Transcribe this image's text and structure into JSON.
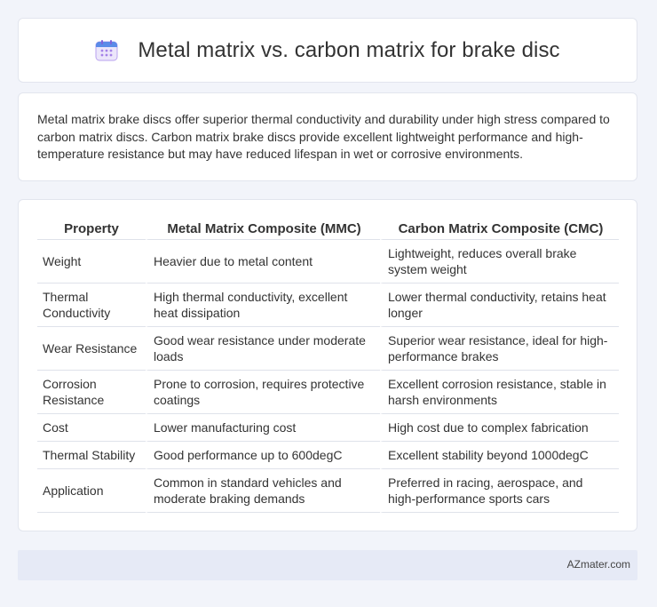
{
  "header": {
    "title": "Metal matrix vs. carbon matrix for brake disc",
    "icon": "calendar-icon"
  },
  "summary": {
    "text": "Metal matrix brake discs offer superior thermal conductivity and durability under high stress compared to carbon matrix discs. Carbon matrix brake discs provide excellent lightweight performance and high-temperature resistance but may have reduced lifespan in wet or corrosive environments."
  },
  "table": {
    "headers": [
      "Property",
      "Metal Matrix Composite (MMC)",
      "Carbon Matrix Composite (CMC)"
    ],
    "rows": [
      [
        "Weight",
        "Heavier due to metal content",
        "Lightweight, reduces overall brake system weight"
      ],
      [
        "Thermal Conductivity",
        "High thermal conductivity, excellent heat dissipation",
        "Lower thermal conductivity, retains heat longer"
      ],
      [
        "Wear Resistance",
        "Good wear resistance under moderate loads",
        "Superior wear resistance, ideal for high-performance brakes"
      ],
      [
        "Corrosion Resistance",
        "Prone to corrosion, requires protective coatings",
        "Excellent corrosion resistance, stable in harsh environments"
      ],
      [
        "Cost",
        "Lower manufacturing cost",
        "High cost due to complex fabrication"
      ],
      [
        "Thermal Stability",
        "Good performance up to 600degC",
        "Excellent stability beyond 1000degC"
      ],
      [
        "Application",
        "Common in standard vehicles and moderate braking demands",
        "Preferred in racing, aerospace, and high-performance sports cars"
      ]
    ]
  },
  "footer": {
    "text": "AZmater.com"
  },
  "colors": {
    "background": "#f2f4fa",
    "card": "#ffffff",
    "footer": "#e6eaf6",
    "icon_purple": "#a582e8",
    "icon_blue": "#5b8be8"
  }
}
